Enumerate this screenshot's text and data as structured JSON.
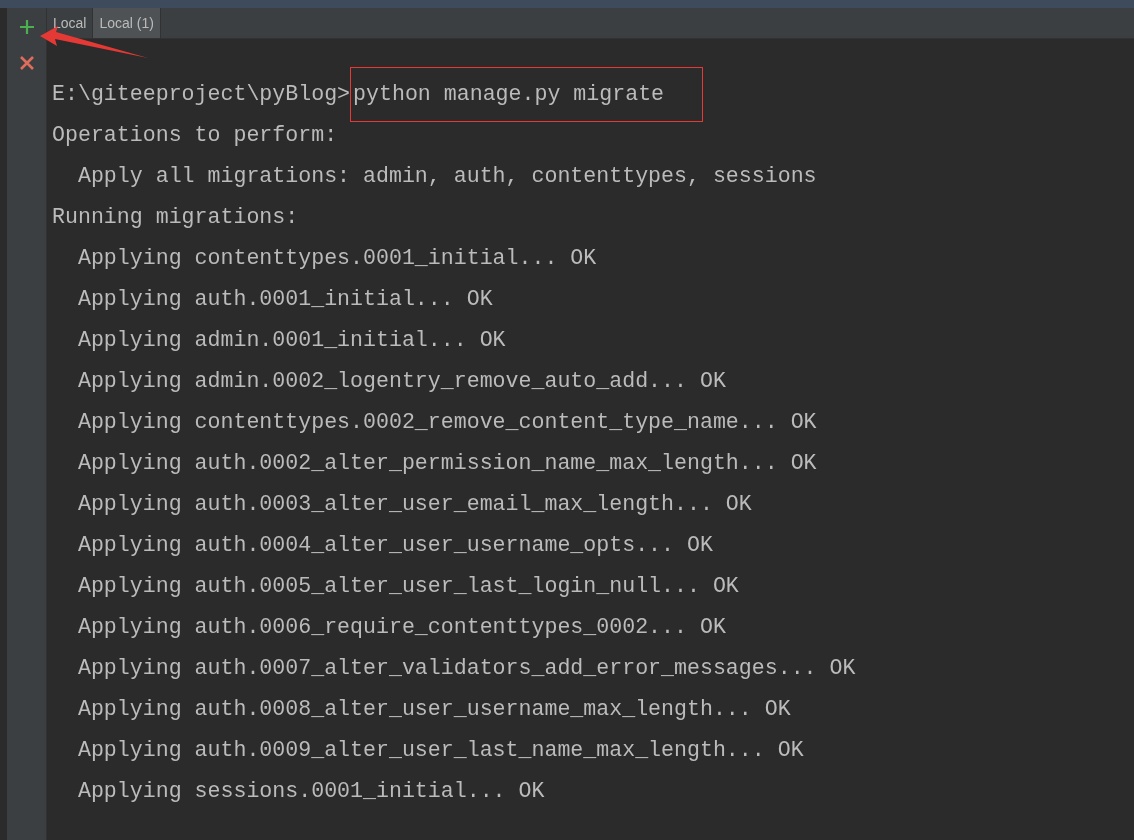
{
  "toolbar": {
    "buttons": [
      {
        "kind": "add"
      },
      {
        "kind": "close"
      }
    ]
  },
  "tabs": [
    {
      "label": "Local",
      "selected": false
    },
    {
      "label": "Local (1)",
      "selected": true
    }
  ],
  "terminal": {
    "prompt": "E:\\giteeproject\\pyBlog>",
    "command": "python manage.py migrate",
    "output": [
      "Operations to perform:",
      "  Apply all migrations: admin, auth, contenttypes, sessions",
      "Running migrations:",
      "  Applying contenttypes.0001_initial... OK",
      "  Applying auth.0001_initial... OK",
      "  Applying admin.0001_initial... OK",
      "  Applying admin.0002_logentry_remove_auto_add... OK",
      "  Applying contenttypes.0002_remove_content_type_name... OK",
      "  Applying auth.0002_alter_permission_name_max_length... OK",
      "  Applying auth.0003_alter_user_email_max_length... OK",
      "  Applying auth.0004_alter_user_username_opts... OK",
      "  Applying auth.0005_alter_user_last_login_null... OK",
      "  Applying auth.0006_require_contenttypes_0002... OK",
      "  Applying auth.0007_alter_validators_add_error_messages... OK",
      "  Applying auth.0008_alter_user_username_max_length... OK",
      "  Applying auth.0009_alter_user_last_name_max_length... OK",
      "  Applying sessions.0001_initial... OK"
    ]
  }
}
